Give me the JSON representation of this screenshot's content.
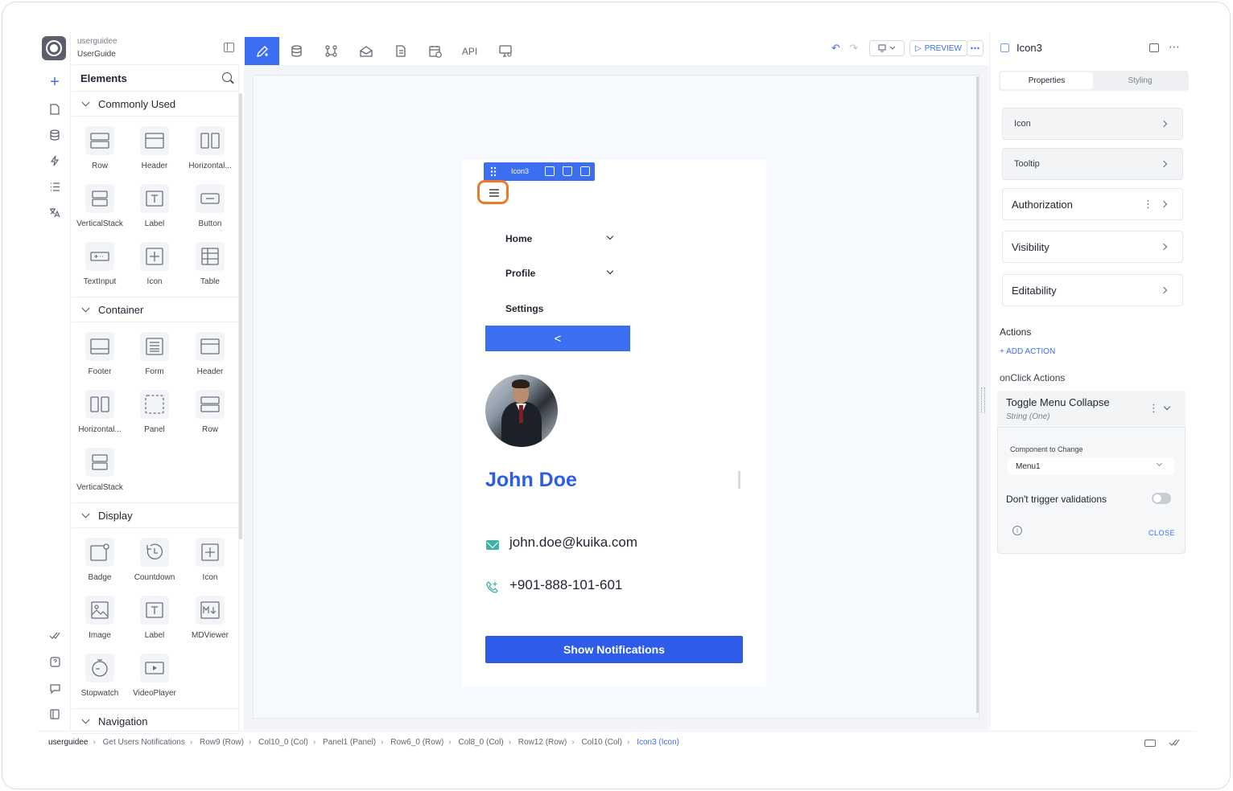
{
  "project": {
    "slug": "userguidee",
    "name": "UserGuide"
  },
  "elements_panel": {
    "title": "Elements",
    "sections": [
      {
        "title": "Commonly Used",
        "items": [
          "Row",
          "Header",
          "Horizontal...",
          "VerticalStack",
          "Label",
          "Button",
          "TextInput",
          "Icon",
          "Table"
        ]
      },
      {
        "title": "Container",
        "items": [
          "Footer",
          "Form",
          "Header",
          "Horizontal...",
          "Panel",
          "Row",
          "VerticalStack"
        ]
      },
      {
        "title": "Display",
        "items": [
          "Badge",
          "Countdown",
          "Icon",
          "Image",
          "Label",
          "MDViewer",
          "Stopwatch",
          "VideoPlayer"
        ]
      },
      {
        "title": "Navigation",
        "items": []
      }
    ]
  },
  "toolbar": {
    "api_label": "API",
    "preview_label": "PREVIEW"
  },
  "canvas": {
    "selected_component": "Icon3",
    "menu": [
      "Home",
      "Profile",
      "Settings"
    ],
    "collapse_glyph": "<",
    "profile_name": "John Doe",
    "email": "john.doe@kuika.com",
    "phone": "+901-888-101-601",
    "notify_button": "Show Notifications"
  },
  "properties": {
    "component_name": "Icon3",
    "tabs": [
      "Properties",
      "Styling"
    ],
    "groups": [
      "Icon",
      "Tooltip",
      "Authorization",
      "Visibility",
      "Editability"
    ],
    "actions_title": "Actions",
    "add_action": "+ ADD ACTION",
    "onclick_title": "onClick Actions",
    "action": {
      "title": "Toggle Menu Collapse",
      "subtitle": "String (One)",
      "field_label": "Component to Change",
      "field_value": "Menu1",
      "toggle_label": "Don't trigger validations",
      "toggle_on": false,
      "close_label": "CLOSE"
    }
  },
  "breadcrumb": [
    "userguidee",
    "Get Users Notifications",
    "Row9 (Row)",
    "Col10_0 (Col)",
    "Panel1 (Panel)",
    "Row6_0 (Row)",
    "Col8_0 (Col)",
    "Row12 (Row)",
    "Col10 (Col)",
    "Icon3 (Icon)"
  ],
  "colors": {
    "accent": "#3b6ef0",
    "highlight": "#f07828",
    "name": "#2d5de8",
    "contact_icon": "#43b0a8"
  }
}
